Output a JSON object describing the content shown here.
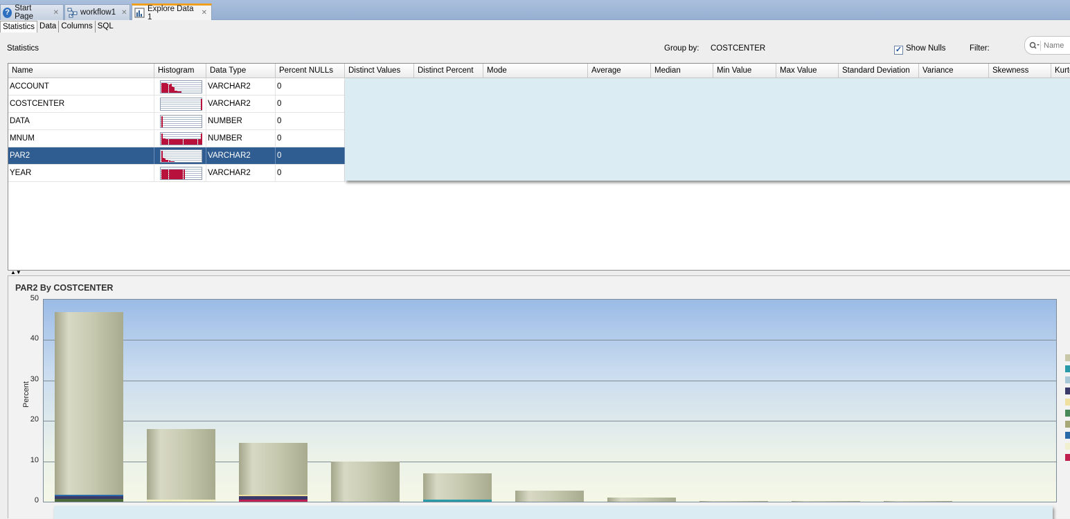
{
  "doc_tabs": [
    {
      "label": "Start Page",
      "icon": "help-icon"
    },
    {
      "label": "workflow1",
      "icon": "workflow-icon"
    },
    {
      "label": "Explore Data 1",
      "icon": "explore-data-icon"
    }
  ],
  "sub_tabs": [
    "Statistics",
    "Data",
    "Columns",
    "SQL"
  ],
  "stats_bar": {
    "title": "Statistics",
    "group_by_label": "Group by:",
    "group_by_value": "COSTCENTER",
    "show_nulls_label": "Show Nulls",
    "show_nulls_checked": true,
    "filter_label": "Filter:",
    "filter_placeholder": "Name"
  },
  "grid": {
    "columns": [
      "Name",
      "Histogram",
      "Data Type",
      "Percent NULLs",
      "Distinct Values",
      "Distinct Percent",
      "Mode",
      "Average",
      "Median",
      "Min Value",
      "Max Value",
      "Standard Deviation",
      "Variance",
      "Skewness",
      "Kurto"
    ],
    "rows": [
      {
        "name": "ACCOUNT",
        "type": "VARCHAR2",
        "nulls": "0",
        "hist": [
          0.8,
          0.85,
          0.8,
          0.85,
          0.75,
          0.7,
          0.75,
          0.55,
          0.5,
          0.2,
          0.15,
          0.1,
          0.1,
          0.1
        ]
      },
      {
        "name": "COSTCENTER",
        "type": "VARCHAR2",
        "nulls": "0",
        "hist": [
          0,
          0,
          0,
          0,
          0,
          0,
          0,
          0,
          0,
          0,
          0,
          0,
          0,
          0,
          0,
          0,
          0,
          0,
          0,
          0,
          0,
          0,
          0,
          0,
          0,
          0,
          0,
          0.95
        ]
      },
      {
        "name": "DATA",
        "type": "NUMBER",
        "nulls": "0",
        "hist": [
          0.95
        ]
      },
      {
        "name": "MNUM",
        "type": "NUMBER",
        "nulls": "0",
        "hist": [
          0.95,
          0.55,
          0.55,
          0.5,
          0.5,
          0.5,
          0.5,
          0.5,
          0.5,
          0.5,
          0.5,
          0.5,
          0.5,
          0.5,
          0.5,
          0.5,
          0.5,
          0.5,
          0.5,
          0.5,
          0.5,
          0.5,
          0.5,
          0.5,
          0.5,
          0.5,
          0.5,
          0.95
        ]
      },
      {
        "name": "PAR2",
        "type": "VARCHAR2",
        "nulls": "0",
        "hist": [
          0.95,
          0.35,
          0.3,
          0.2,
          0.15,
          0.1,
          0.05,
          0.05,
          0.05
        ],
        "selected": true
      },
      {
        "name": "YEAR",
        "type": "VARCHAR2",
        "nulls": "0",
        "hist": [
          0.8,
          0.8,
          0.8,
          0.8,
          0.8,
          0.8,
          0.8,
          0.8,
          0.8,
          0.8,
          0.8,
          0.8,
          0.8,
          0.8,
          0.8,
          0.8
        ]
      }
    ]
  },
  "chart_data": {
    "type": "bar",
    "title": "PAR2 By COSTCENTER",
    "xlabel": "",
    "ylabel": "Percent",
    "ylim": [
      0,
      50
    ],
    "yticks": [
      0,
      10,
      20,
      30,
      40,
      50
    ],
    "grid": true,
    "legend": "right",
    "values": [
      47,
      18,
      14.5,
      10,
      7,
      2.8,
      1,
      0.2,
      0.2,
      0.2
    ],
    "colors": {
      "bar": "#c7c9b0",
      "legend": [
        "#c8c8a8",
        "#2a9aa8",
        "#a8c8d8",
        "#3a3a6a",
        "#f0e0a0",
        "#4a8a5a",
        "#a8a878",
        "#2a6aa8",
        "#f0f0d0",
        "#c02050"
      ],
      "segments": [
        [
          {
            "c": "#4a6a3a",
            "v": 0.7
          },
          {
            "c": "#3a3a6a",
            "v": 0.6
          },
          {
            "c": "#2a6aa8",
            "v": 0.5
          }
        ],
        [
          {
            "c": "#f0f0c0",
            "v": 0.6
          }
        ],
        [
          {
            "c": "#c02050",
            "v": 0.6
          },
          {
            "c": "#3a3a6a",
            "v": 0.7
          },
          {
            "c": "#f0e0a0",
            "v": 0.4
          }
        ],
        [],
        [
          {
            "c": "#2a9aa8",
            "v": 0.5
          }
        ],
        [],
        [],
        [],
        [],
        []
      ]
    }
  }
}
